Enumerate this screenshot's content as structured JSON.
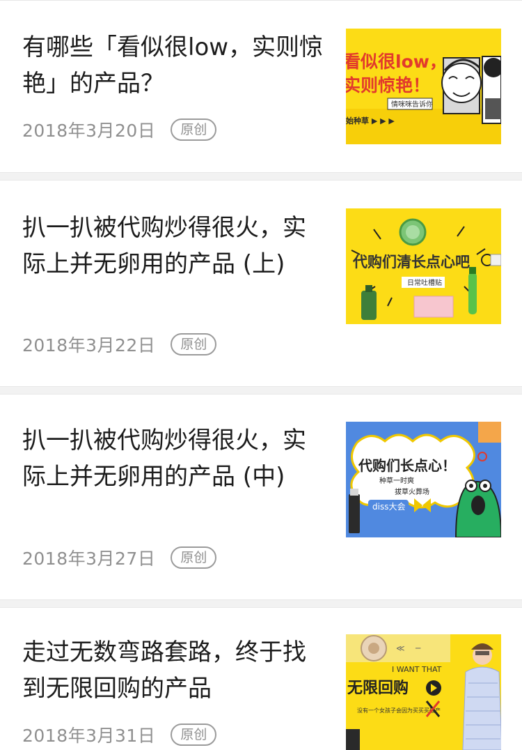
{
  "articles": [
    {
      "title": "有哪些「看似很low，实则惊艳」的产品？",
      "date": "2018年3月20日",
      "badge": "原创",
      "thumb": {
        "headline_1": "看似很low，",
        "headline_2": "实则惊艳！",
        "caption": "情咪咪告诉你",
        "footer": "始种草 ▶ ▶ ▶"
      }
    },
    {
      "title": "扒一扒被代购炒得很火，实际上并无卵用的产品 (上)",
      "date": "2018年3月22日",
      "badge": "原创",
      "thumb": {
        "headline": "代购们清长点心吧",
        "caption": "日常吐槽贴"
      }
    },
    {
      "title": "扒一扒被代购炒得很火，实际上并无卵用的产品 (中)",
      "date": "2018年3月27日",
      "badge": "原创",
      "thumb": {
        "headline": "代购们长点心！",
        "sub_1": "种草一时爽",
        "sub_2": "拔草火葬场",
        "tag": "diss大会"
      }
    },
    {
      "title": "走过无数弯路套路，终于找到无限回购的产品",
      "date": "2018年3月31日",
      "badge": "原创",
      "thumb": {
        "top": "I  WANT THAT",
        "headline": "无限回购",
        "caption": "没有一个女孩子会因为买买买破产"
      }
    }
  ],
  "colors": {
    "yellow": "#fcdc16",
    "blue": "#5089e0",
    "green": "#27ae60",
    "red": "#e23a2c"
  }
}
